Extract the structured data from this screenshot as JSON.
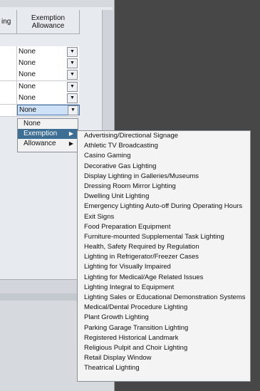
{
  "table": {
    "left_header": "ing",
    "header": "Exemption\nAllowance",
    "rows": [
      "None",
      "None",
      "None",
      "None",
      "None",
      "None"
    ],
    "active_row_index": 5
  },
  "dropdown_menu": {
    "items": [
      {
        "label": "None",
        "has_submenu": false
      },
      {
        "label": "Exemption",
        "has_submenu": true
      },
      {
        "label": "Allowance",
        "has_submenu": true
      }
    ],
    "hovered": "Exemption"
  },
  "submenu": {
    "items": [
      "Advertising/Directional Signage",
      "Athletic TV Broadcasting",
      "Casino Gaming",
      "Decorative Gas Lighting",
      "Display Lighting in Galleries/Museums",
      "Dressing Room Mirror Lighting",
      "Dwelling Unit Lighting",
      "Emergency Lighting Auto-off During Operating Hours",
      "Exit Signs",
      "Food Preparation Equipment",
      "Furniture-mounted Supplemental Task Lighting",
      "Health, Safety Required by Regulation",
      "Lighting in Refrigerator/Freezer Cases",
      "Lighting for Visually Impaired",
      "Lighting for Medical/Age Related Issues",
      "Lighting Integral to Equipment",
      "Lighting Sales or Educational Demonstration Systems",
      "Medical/Dental Procedure Lighting",
      "Plant Growth Lighting",
      "Parking Garage Transition Lighting",
      "Registered Historical Landmark",
      "Religious Pulpit and Choir Lighting",
      "Retail Display Window",
      "Theatrical Lighting"
    ]
  }
}
